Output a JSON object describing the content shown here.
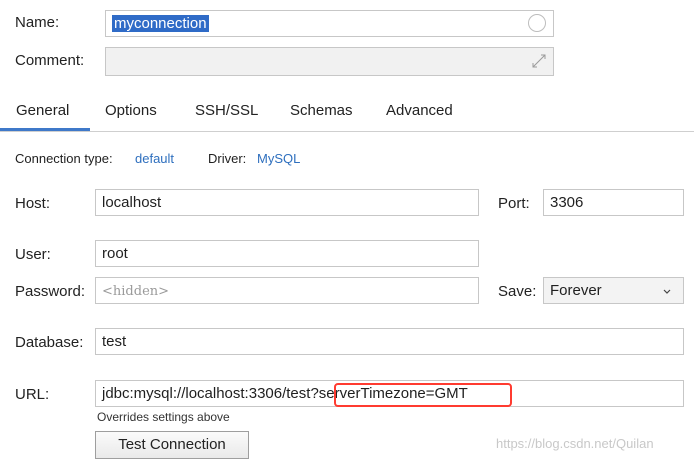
{
  "form": {
    "name_label": "Name:",
    "name_value": "myconnection",
    "comment_label": "Comment:",
    "comment_value": ""
  },
  "tabs": [
    {
      "label": "General"
    },
    {
      "label": "Options"
    },
    {
      "label": "SSH/SSL"
    },
    {
      "label": "Schemas"
    },
    {
      "label": "Advanced"
    }
  ],
  "general": {
    "connection_type_label": "Connection type:",
    "connection_type_value": "default",
    "driver_label": "Driver:",
    "driver_value": "MySQL",
    "host_label": "Host:",
    "host_value": "localhost",
    "port_label": "Port:",
    "port_value": "3306",
    "user_label": "User:",
    "user_value": "root",
    "password_label": "Password:",
    "password_placeholder": "<hidden>",
    "save_label": "Save:",
    "save_value": "Forever",
    "database_label": "Database:",
    "database_value": "test",
    "url_label": "URL:",
    "url_value": "jdbc:mysql://localhost:3306/test?serverTimezone=GMT",
    "override_note": "Overrides settings above",
    "test_button": "Test Connection"
  },
  "watermark": "https://blog.csdn.net/Quilan",
  "colors": {
    "accent": "#3f79c9",
    "selection": "#2f6bc7",
    "link": "#2e6fbe",
    "highlight_box": "#ff3b30"
  },
  "icons": {
    "name_status": "circle-icon",
    "comment_expand": "expand-icon",
    "save_dropdown": "chevron-down-icon"
  }
}
